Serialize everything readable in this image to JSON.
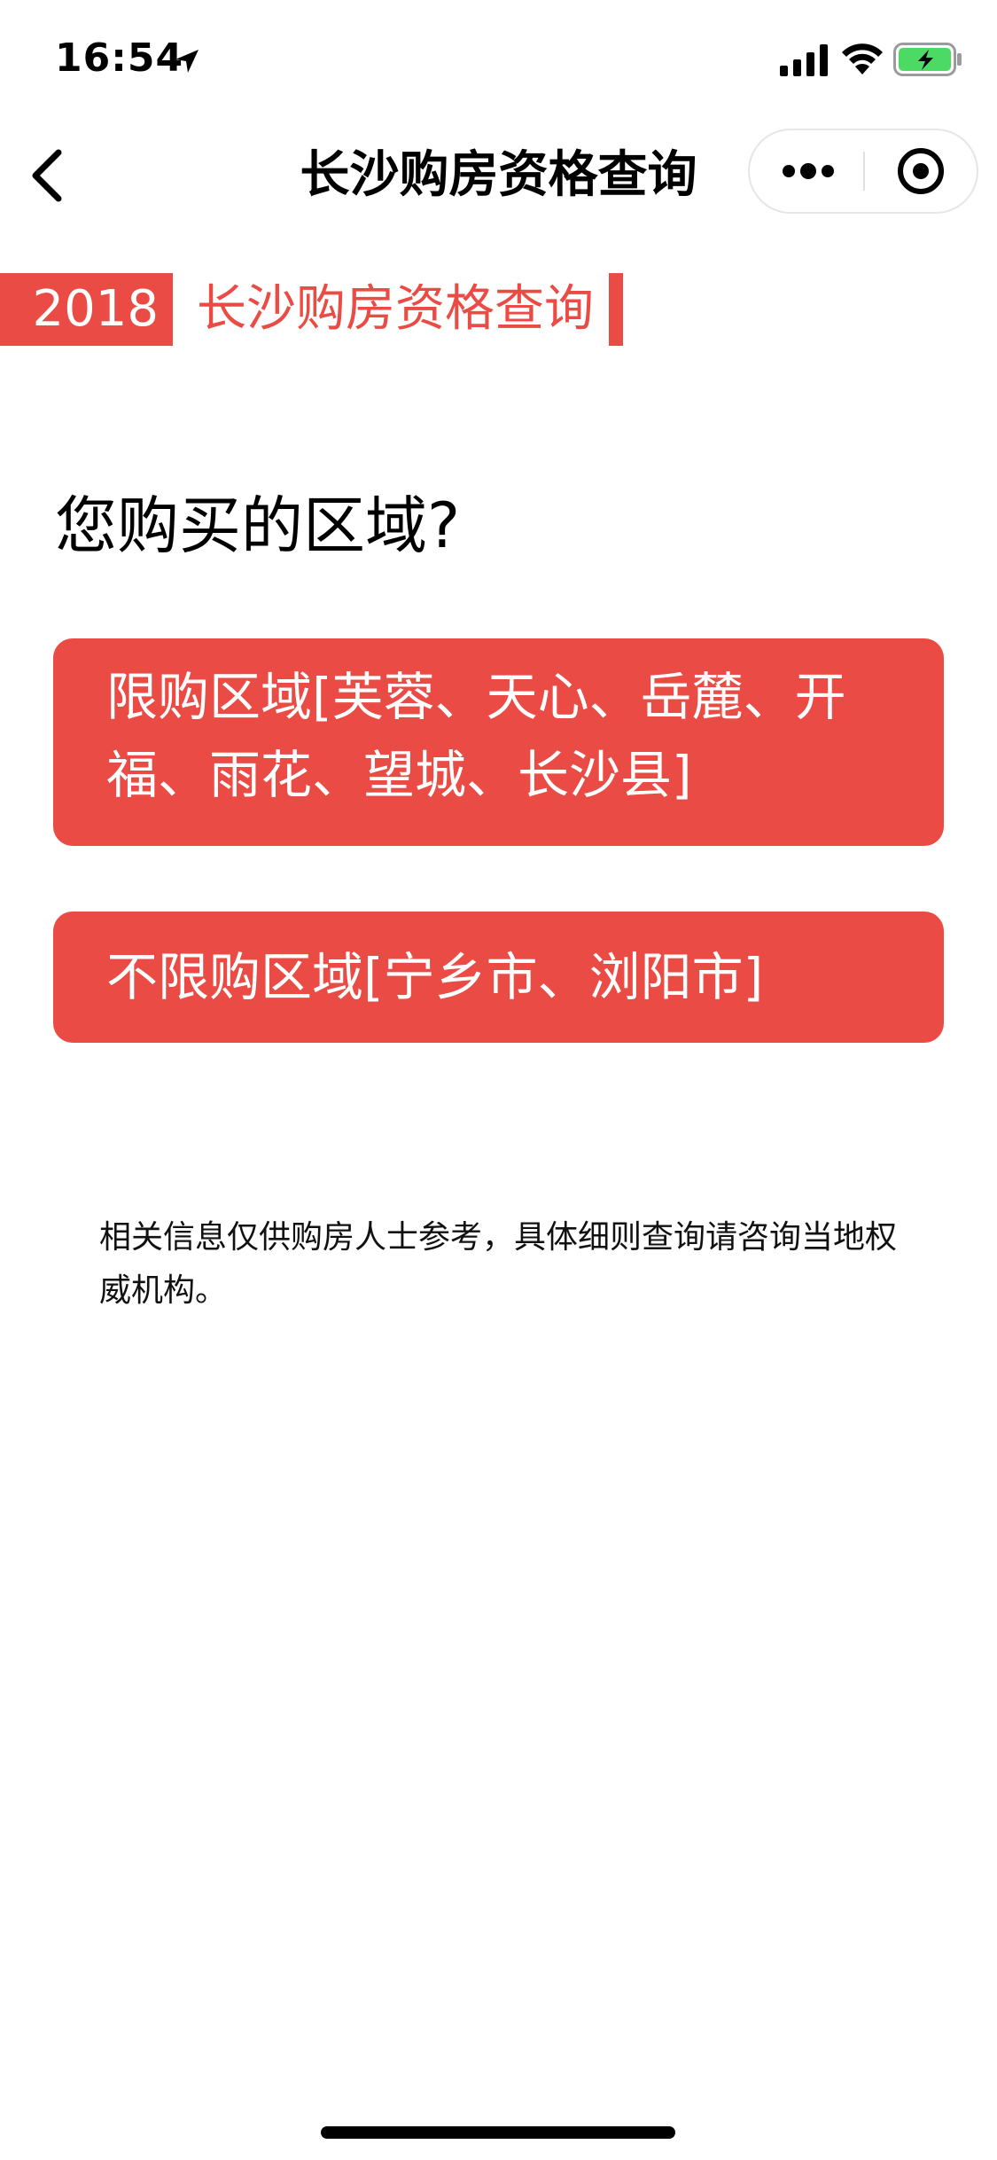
{
  "status_bar": {
    "time": "16:54",
    "battery_color": "#4cd964"
  },
  "nav": {
    "title": "长沙购房资格查询"
  },
  "banner": {
    "year": "2018",
    "title": "长沙购房资格查询",
    "accent_color": "#ea4b44"
  },
  "question": {
    "text": "您购买的区域?"
  },
  "options": [
    {
      "label": "限购区域[芙蓉、天心、岳麓、开福、雨花、望城、长沙县]"
    },
    {
      "label": "不限购区域[宁乡市、浏阳市]"
    }
  ],
  "disclaimer": {
    "text": "相关信息仅供购房人士参考，具体细则查询请咨询当地权威机构。"
  }
}
